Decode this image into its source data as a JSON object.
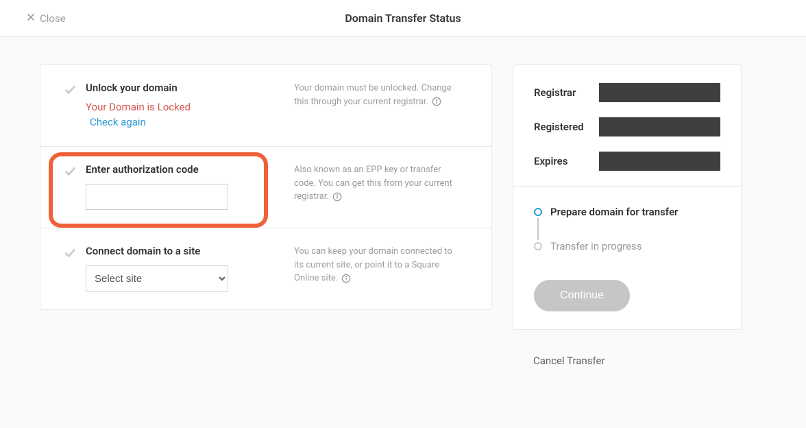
{
  "topbar": {
    "close_label": "Close",
    "title": "Domain Transfer Status"
  },
  "steps": {
    "unlock": {
      "title": "Unlock your domain",
      "locked_msg": "Your Domain is Locked",
      "check_again": "Check again",
      "desc": "Your domain must be unlocked. Change this through your current registrar."
    },
    "auth": {
      "title": "Enter authorization code",
      "desc": "Also known as an EPP key or transfer code. You can get this from your current registrar."
    },
    "connect": {
      "title": "Connect domain to a site",
      "select_placeholder": "Select site",
      "desc": "You can keep your domain connected to its current site, or point it to a Square Online site."
    }
  },
  "info": {
    "registrar_label": "Registrar",
    "registered_label": "Registered",
    "expires_label": "Expires"
  },
  "progress": {
    "prepare": "Prepare domain for transfer",
    "inprogress": "Transfer in progress",
    "continue_label": "Continue"
  },
  "cancel_label": "Cancel Transfer"
}
